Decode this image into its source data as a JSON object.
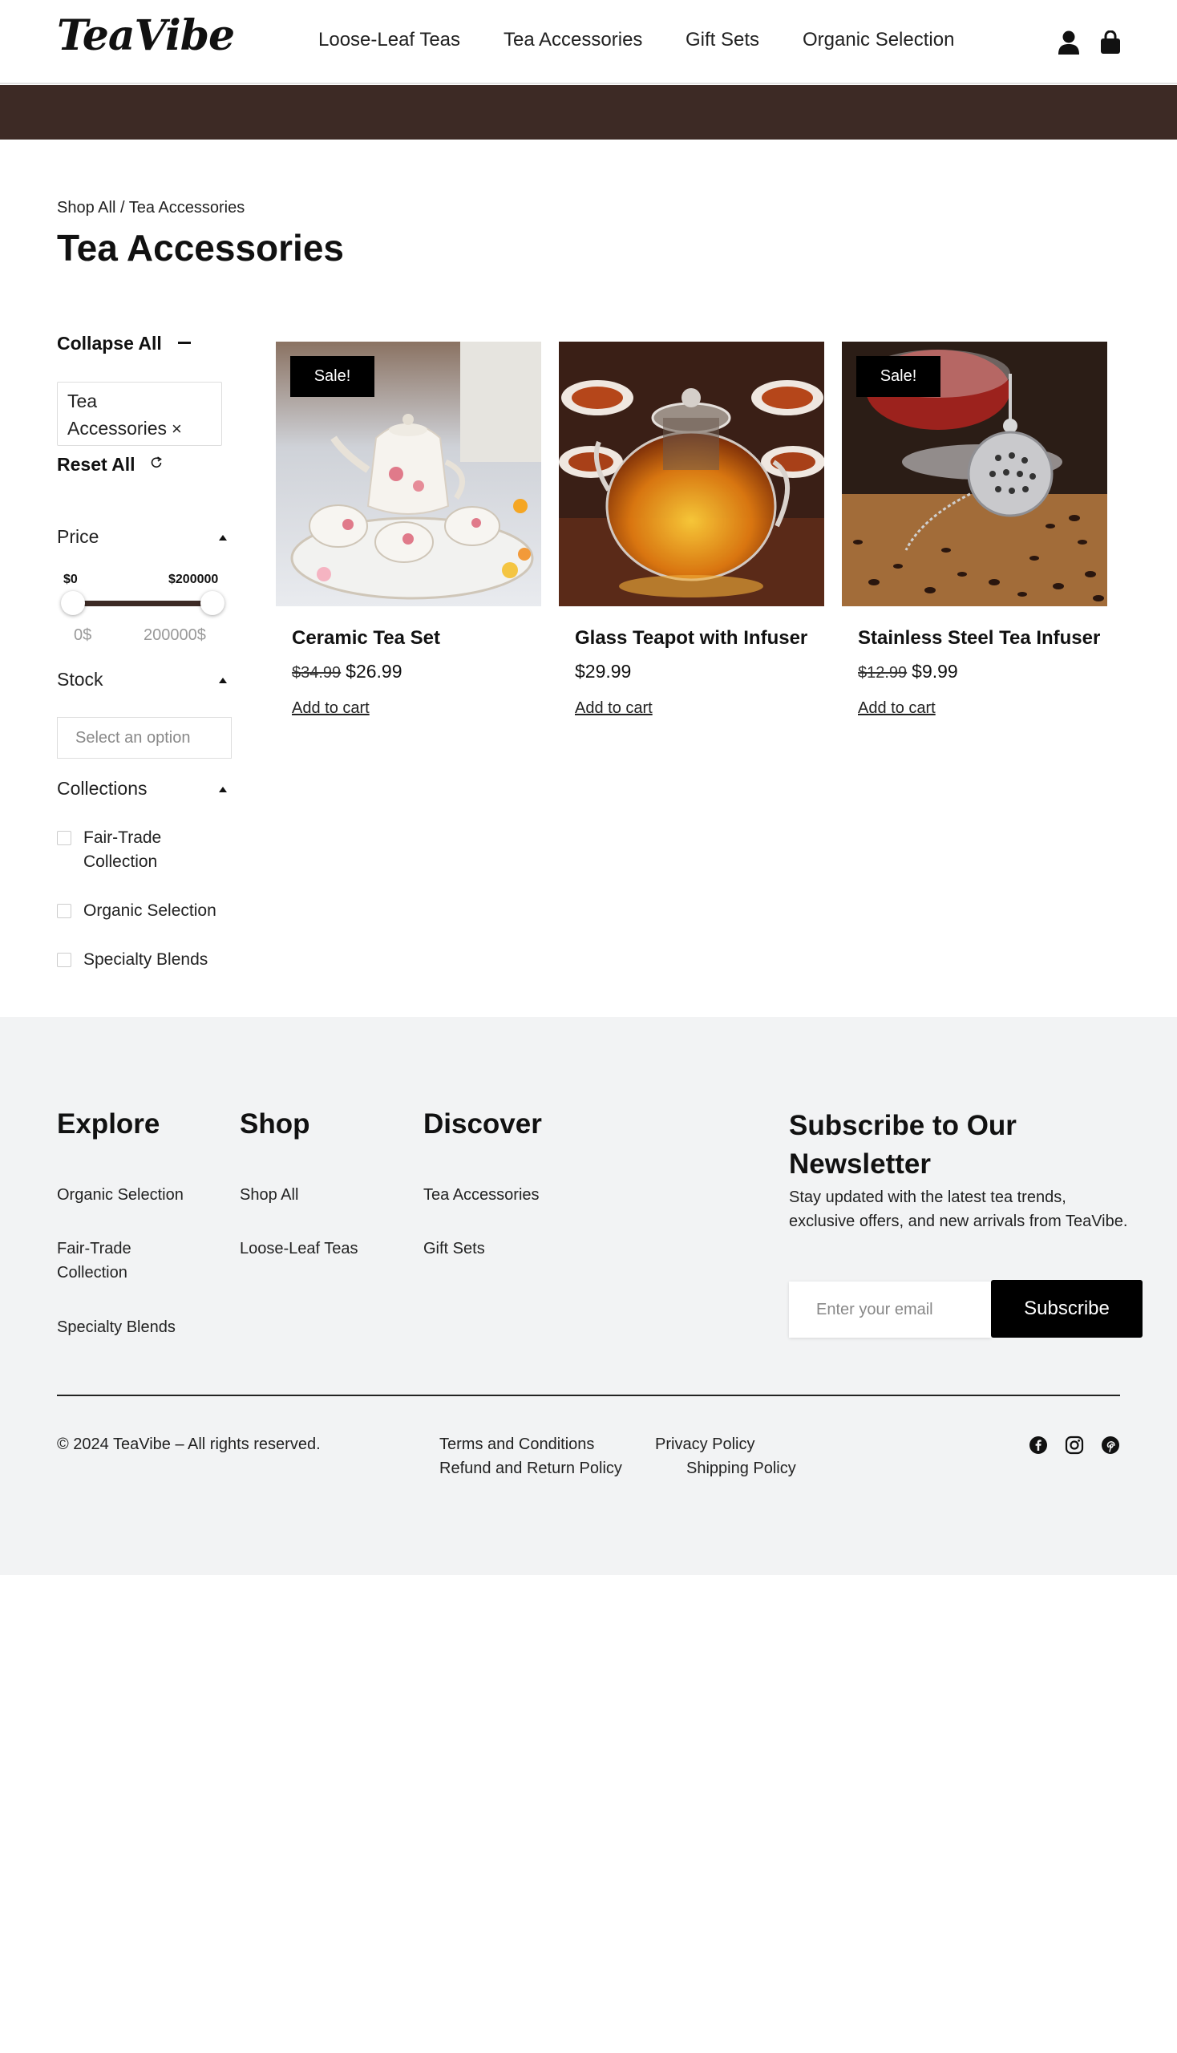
{
  "header": {
    "logo": "TeaVibe",
    "nav": [
      "Loose-Leaf Teas",
      "Tea Accessories",
      "Gift Sets",
      "Organic Selection"
    ],
    "icons": [
      "user-icon",
      "shopping-bag-icon"
    ]
  },
  "banner": {
    "color": "#3d2a25"
  },
  "breadcrumb": "Shop All / Tea Accessories",
  "page_title": "Tea Accessories",
  "sidebar": {
    "collapse_all": "Collapse All",
    "active_filter": "Tea Accessories",
    "active_filter_remove": "×",
    "reset_all": "Reset All",
    "price": {
      "title": "Price",
      "min_label": "$0",
      "max_label": "$200000",
      "min_value": "0$",
      "max_value": "200000$"
    },
    "stock": {
      "title": "Stock",
      "placeholder": "Select an option"
    },
    "collections": {
      "title": "Collections",
      "items": [
        "Fair-Trade Collection",
        "Organic Selection",
        "Specialty Blends"
      ]
    }
  },
  "products": [
    {
      "name": "Ceramic Tea Set",
      "badge": "Sale!",
      "old_price": "$34.99",
      "price": "$26.99",
      "cta": "Add to cart"
    },
    {
      "name": "Glass Teapot with Infuser",
      "badge": "",
      "old_price": "",
      "price": "$29.99",
      "cta": "Add to cart"
    },
    {
      "name": "Stainless Steel Tea Infuser",
      "badge": "Sale!",
      "old_price": "$12.99",
      "price": "$9.99",
      "cta": "Add to cart"
    }
  ],
  "footer": {
    "explore": {
      "title": "Explore",
      "links": [
        "Organic Selection",
        "Fair-Trade Collection",
        "Specialty Blends"
      ]
    },
    "shop": {
      "title": "Shop",
      "links": [
        "Shop All",
        "Loose-Leaf Teas"
      ]
    },
    "discover": {
      "title": "Discover",
      "links": [
        "Tea Accessories",
        "Gift Sets"
      ]
    },
    "newsletter": {
      "title": "Subscribe to Our Newsletter",
      "description": "Stay updated with the latest tea trends, exclusive offers, and new arrivals from TeaVibe.",
      "placeholder": "Enter your email",
      "button": "Subscribe"
    },
    "copyright": "© 2024 TeaVibe – All rights reserved.",
    "legal": [
      "Terms and Conditions",
      "Privacy Policy",
      "Refund and Return Policy",
      "Shipping Policy"
    ],
    "social": [
      "facebook-icon",
      "instagram-icon",
      "pinterest-icon"
    ]
  }
}
